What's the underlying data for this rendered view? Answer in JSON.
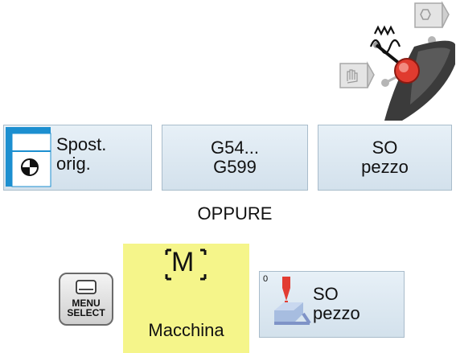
{
  "softkeys_top": [
    {
      "id": "spost",
      "line1": "Spost.",
      "line2": "orig."
    },
    {
      "id": "g54",
      "line1": "G54...",
      "line2": "G599"
    },
    {
      "id": "so",
      "line1": "SO",
      "line2": "pezzo"
    }
  ],
  "oppure": "OPPURE",
  "menu_select": {
    "line1": "MENU",
    "line2": "SELECT"
  },
  "macchina": {
    "icon_letter": "M",
    "label": "Macchina"
  },
  "so_bottom": {
    "line1": "SO",
    "line2": "pezzo",
    "marker": "0"
  },
  "icons": [
    "handwheel-icon",
    "zero-offset-icon",
    "machine-m-icon",
    "workpiece-zero-icon",
    "menu-select-key-icon"
  ],
  "colors": {
    "softkey_bg": "#dbe7f0",
    "softkey_border": "#a9bccb",
    "accent_blue": "#1c8fd0",
    "yellow": "#f5f58a",
    "red_knob": "#e03b2f"
  }
}
